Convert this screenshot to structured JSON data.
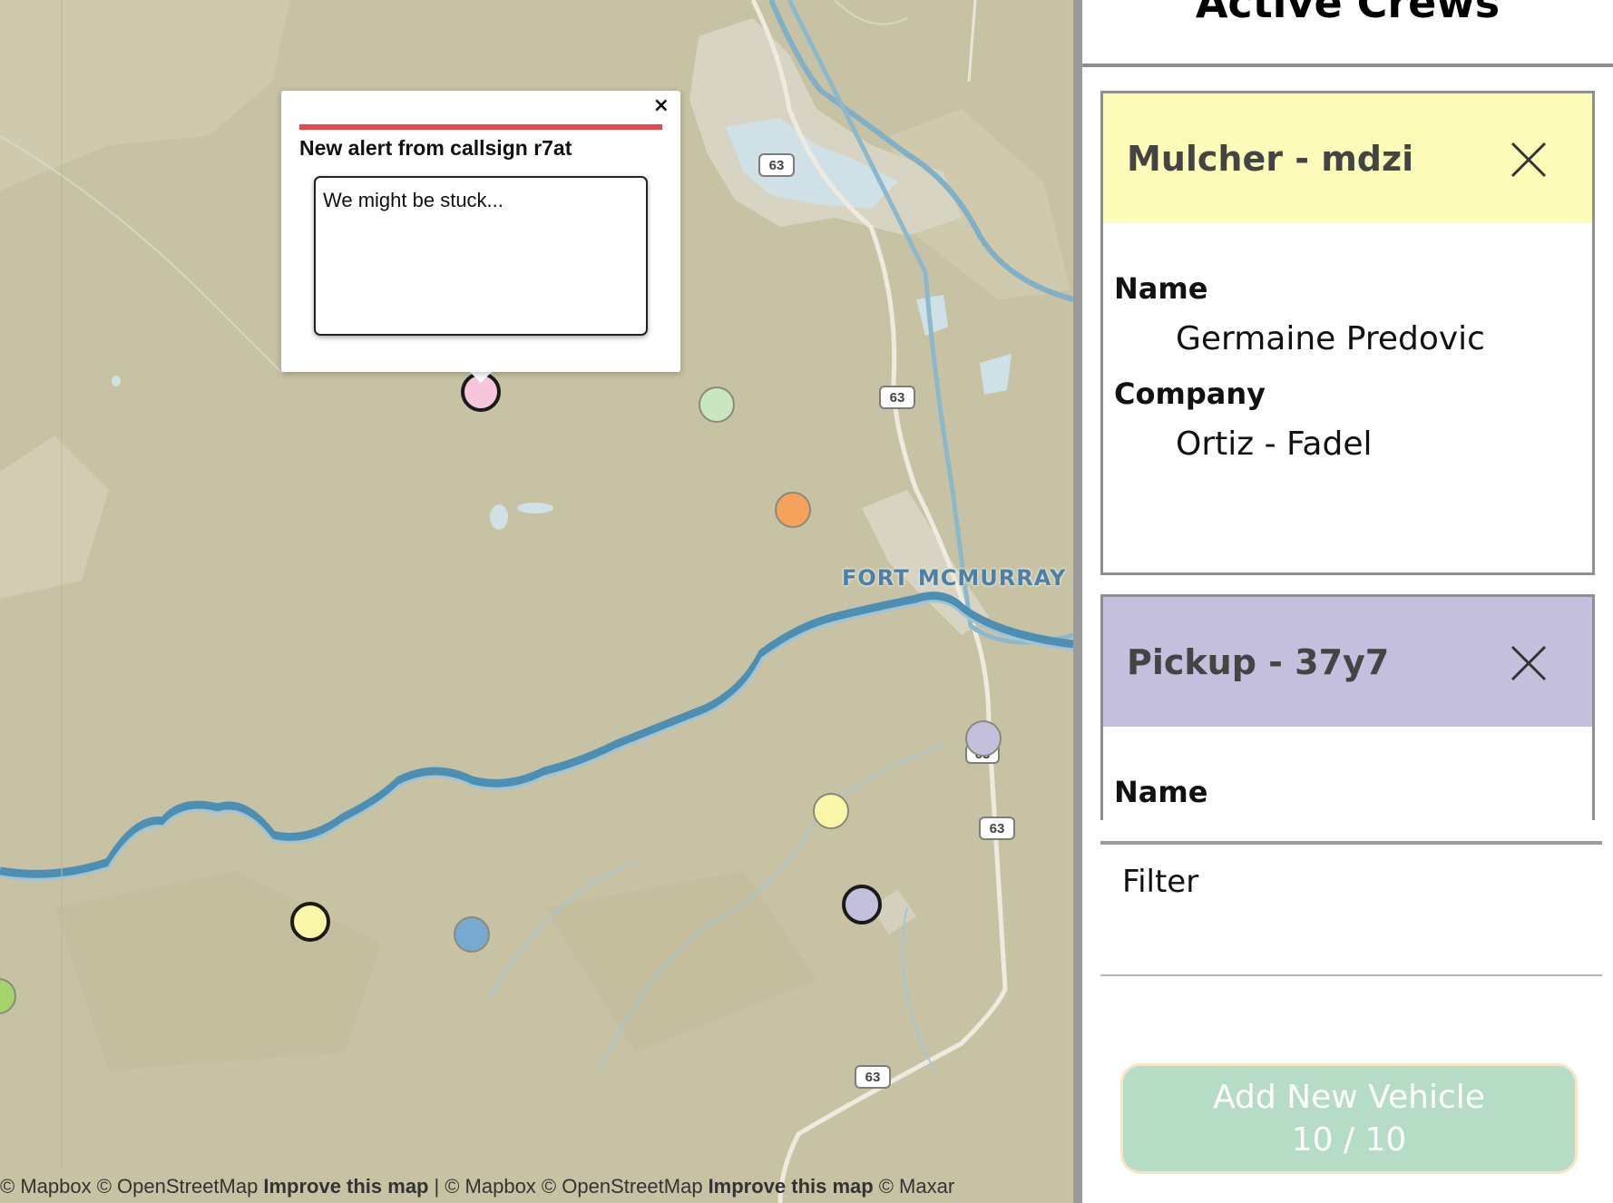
{
  "map": {
    "city_label": "FORT MCMURRAY",
    "highway_shields": [
      "63",
      "63",
      "63",
      "63",
      "63"
    ],
    "attribution": {
      "part1": "© Mapbox © OpenStreetMap",
      "link1": "Improve this map",
      "separator": "|",
      "part2": "© Mapbox © OpenStreetMap",
      "link2": "Improve this map",
      "part3": "© Maxar"
    },
    "markers": [
      {
        "color": "#f7c6dc",
        "style": "bold"
      },
      {
        "color": "#c9e6c1",
        "style": "thin"
      },
      {
        "color": "#f6a15c",
        "style": "thin"
      },
      {
        "color": "#c3bfdc",
        "style": "thin"
      },
      {
        "color": "#fbf7a8",
        "style": "thin"
      },
      {
        "color": "#c3bfdc",
        "style": "bold"
      },
      {
        "color": "#fbf7a8",
        "style": "bold"
      },
      {
        "color": "#78a9cf",
        "style": "thin"
      },
      {
        "color": "#a6d46a",
        "style": "thin"
      }
    ]
  },
  "popup": {
    "close_label": "×",
    "title": "New alert from callsign r7at",
    "message": "We might be stuck..."
  },
  "sidebar": {
    "title": "Active Crews",
    "crews": [
      {
        "header": "Mulcher - mdzi",
        "color": "#fdfcb9",
        "name_label": "Name",
        "name": "Germaine Predovic",
        "company_label": "Company",
        "company": "Ortiz - Fadel"
      },
      {
        "header": "Pickup - 37y7",
        "color": "#c3bfdc",
        "name_label": "Name"
      }
    ],
    "filter_placeholder": "Filter",
    "add_button": {
      "label": "Add New Vehicle",
      "count": "10 / 10"
    }
  }
}
